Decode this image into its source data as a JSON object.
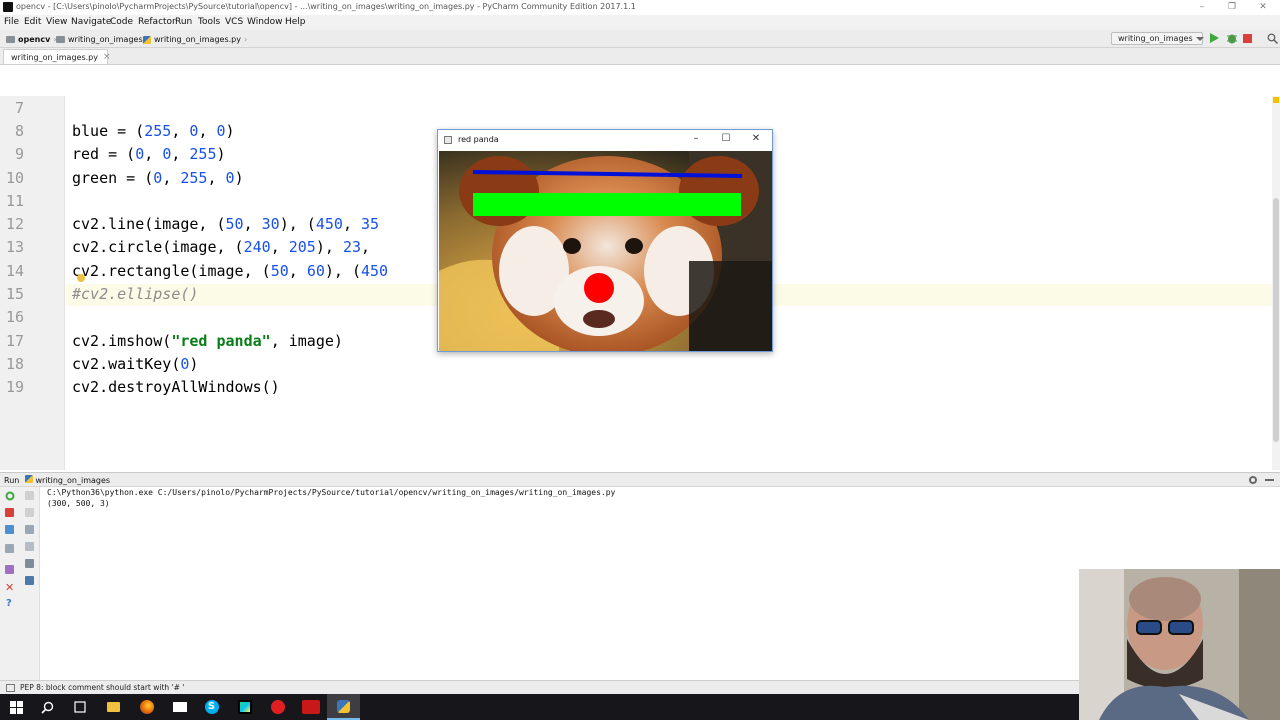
{
  "window": {
    "title": "opencv - [C:\\Users\\pinolo\\PycharmProjects\\PySource\\tutorial\\opencv] - ...\\writing_on_images\\writing_on_images.py - PyCharm Community Edition 2017.1.1",
    "controls": [
      "–",
      "❐",
      "✕"
    ]
  },
  "menu": [
    "File",
    "Edit",
    "View",
    "Navigate",
    "Code",
    "Refactor",
    "Run",
    "Tools",
    "VCS",
    "Window",
    "Help"
  ],
  "breadcrumb": [
    "opencv",
    "writing_on_images",
    "writing_on_images.py"
  ],
  "run_config": "writing_on_images",
  "tab": {
    "label": "writing_on_images.py",
    "close": "×"
  },
  "editor": {
    "line_numbers": [
      "7",
      "8",
      "9",
      "10",
      "11",
      "12",
      "13",
      "14",
      "15",
      "16",
      "17",
      "18",
      "19"
    ],
    "lines": {
      "l8": [
        "blue = (",
        "255",
        ", ",
        "0",
        ", ",
        "0",
        ")"
      ],
      "l9": [
        "red = (",
        "0",
        ", ",
        "0",
        ", ",
        "255",
        ")"
      ],
      "l10": [
        "green = (",
        "0",
        ", ",
        "255",
        ", ",
        "0",
        ")"
      ],
      "l12": [
        "cv2.line(image, (",
        "50",
        ", ",
        "30",
        "), (",
        "450",
        ", ",
        "35"
      ],
      "l13": [
        "cv2.circle(image, (",
        "240",
        ", ",
        "205",
        "), ",
        "23",
        ", "
      ],
      "l14": [
        "cv2.rectangle(image, (",
        "50",
        ", ",
        "60",
        "), (",
        "450"
      ],
      "l15": "#cv2.ellipse()",
      "l17": [
        "cv2.imshow(",
        "\"red panda\"",
        ", image)"
      ],
      "l18": [
        "cv2.waitKey(",
        "0",
        ")"
      ],
      "l19": "cv2.destroyAllWindows()"
    }
  },
  "image_window": {
    "title": "red panda",
    "controls": [
      "–",
      "☐",
      "✕"
    ]
  },
  "run_panel": {
    "title": "Run",
    "config": "writing_on_images",
    "console": [
      "C:\\Python36\\python.exe C:/Users/pinolo/PycharmProjects/PySource/tutorial/opencv/writing_on_images/writing_on_images.py",
      "(300, 500, 3)"
    ]
  },
  "status": "PEP 8: block comment should start with '# '",
  "colors": {
    "accent": "#76b9ed",
    "blue_line": "#0012d9",
    "green_rect": "#00ff00",
    "red_circle": "#ff0000"
  }
}
